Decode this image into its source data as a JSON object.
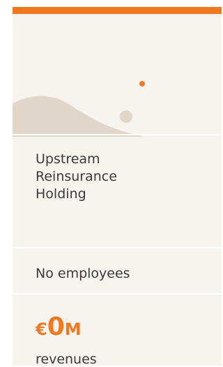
{
  "company": {
    "name_lines": [
      "Upstream",
      "Reinsurance",
      "Holding"
    ],
    "employees_text": "No employees",
    "revenue": {
      "currency": "€",
      "value": "0",
      "unit": "M",
      "label": "revenues"
    }
  },
  "colors": {
    "accent": "#f07820",
    "card_bg": "#f7f4ef",
    "shape": "#e0d6c9",
    "text": "#3a3a3a"
  }
}
